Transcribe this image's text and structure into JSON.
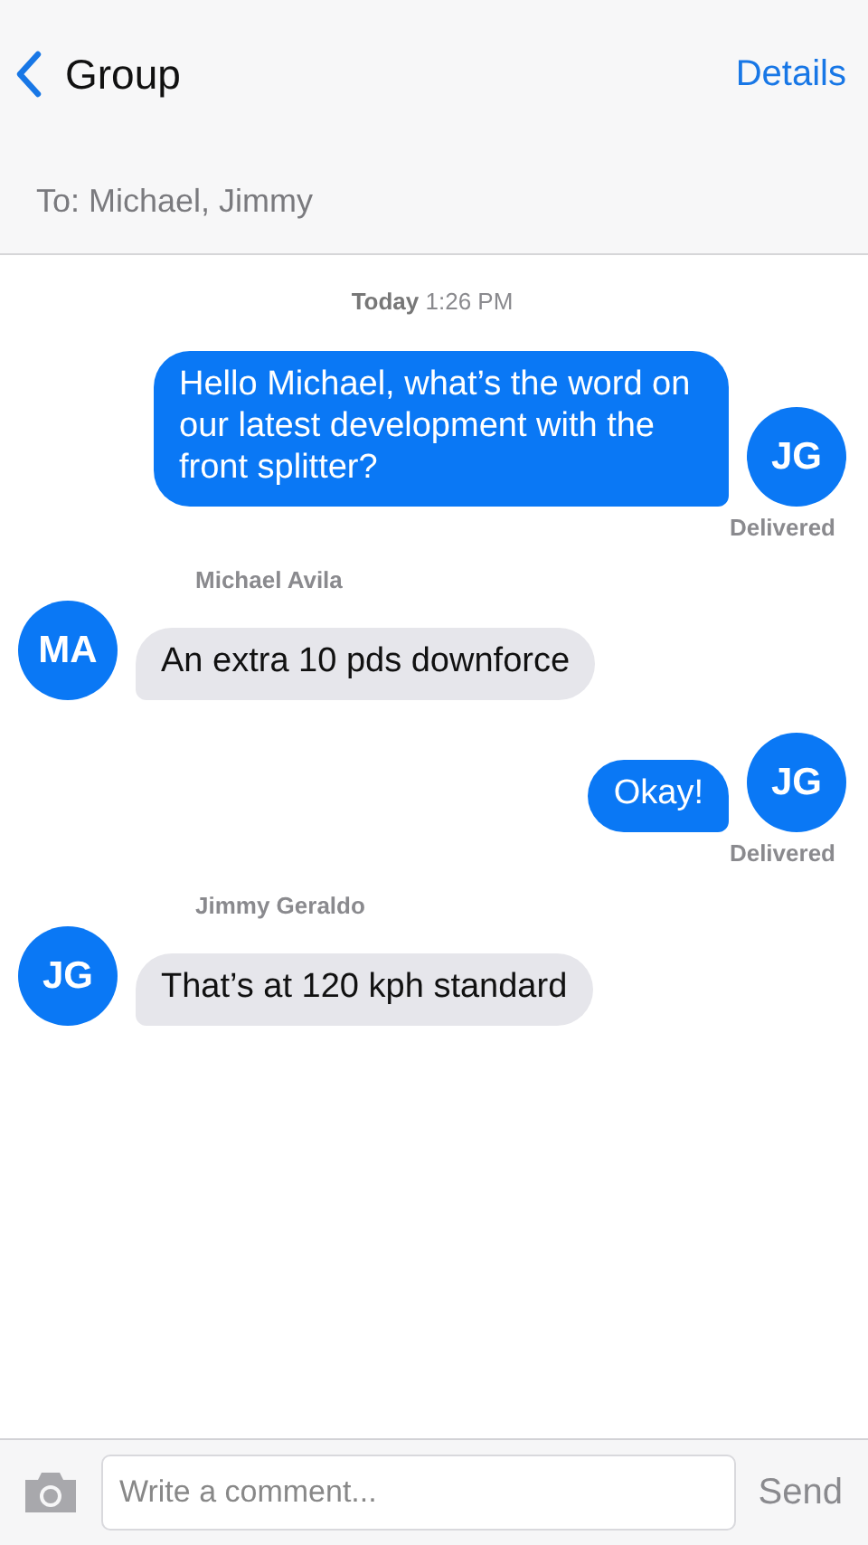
{
  "header": {
    "back_label": "Group",
    "action": "Details"
  },
  "recipients": "To: Michael, Jimmy",
  "timestamp": "**Today** 1:26 PM",
  "messages": [
    {
      "kind": "outgoing",
      "text": "Hello Michael, what’s the word on our latest development with the front splitter?",
      "avatar": "JG",
      "status": "Delivered"
    },
    {
      "kind": "incoming",
      "sender": "Michael Avila",
      "text": "An extra 10 pds downforce",
      "avatar": "MA"
    },
    {
      "kind": "outgoing",
      "text": "Okay!",
      "avatar": "JG",
      "status": "Delivered"
    },
    {
      "kind": "incoming",
      "sender": "Jimmy Geraldo",
      "text": "That’s at 120 kph standard",
      "avatar": "JG"
    }
  ],
  "composer": {
    "placeholder": "Write a comment...",
    "send": "Send"
  }
}
